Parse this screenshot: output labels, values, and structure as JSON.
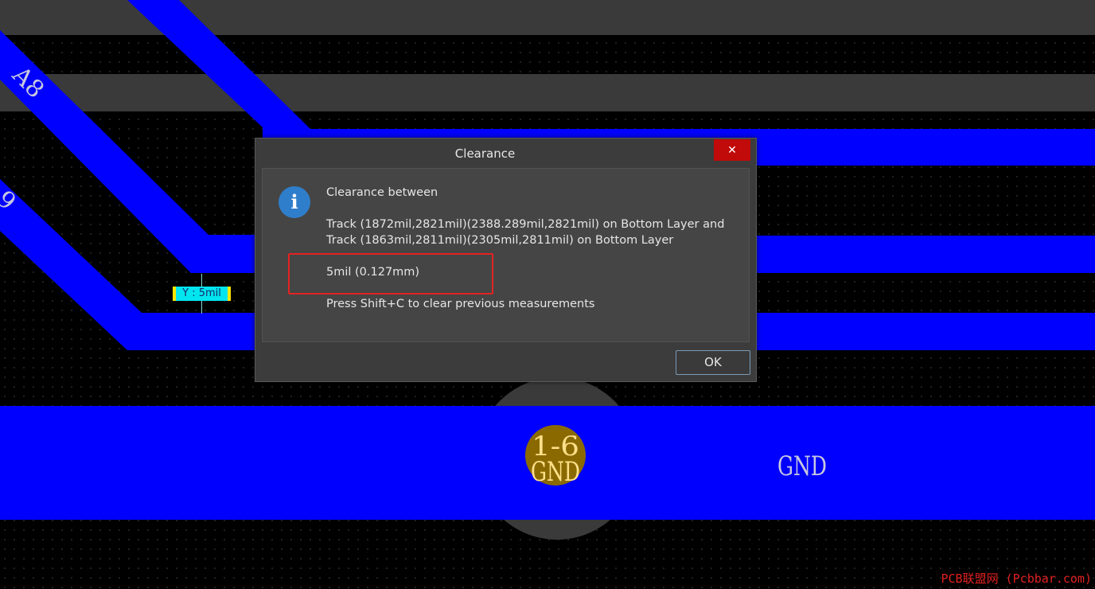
{
  "pcb": {
    "net_label_a8": "A8",
    "net_label_partial": "9",
    "pad_designator": "1-6",
    "pad_net": "GND",
    "track_net_label": "GND",
    "measurement_label": "Y : 5mil",
    "colors": {
      "track": "#0000ff",
      "gray_track": "#3a3a3a",
      "pad": "#8a6a00",
      "pad_text": "#ffe08a",
      "measure_bg": "#00e5ee",
      "measure_edge": "#ffe600"
    }
  },
  "dialog": {
    "title": "Clearance",
    "close_icon": "close-icon",
    "info_icon": "info-icon",
    "info_glyph": "i",
    "heading": "Clearance between",
    "track_line_1": "Track (1872mil,2821mil)(2388.289mil,2821mil) on Bottom Layer and",
    "track_line_2": "Track (1863mil,2811mil)(2305mil,2811mil) on Bottom Layer",
    "clearance_value": "5mil (0.127mm)",
    "hint": "Press Shift+C to clear previous measurements",
    "ok_label": "OK",
    "highlight_color": "#e52222"
  },
  "watermark": "PCB联盟网 (Pcbbar.com)"
}
